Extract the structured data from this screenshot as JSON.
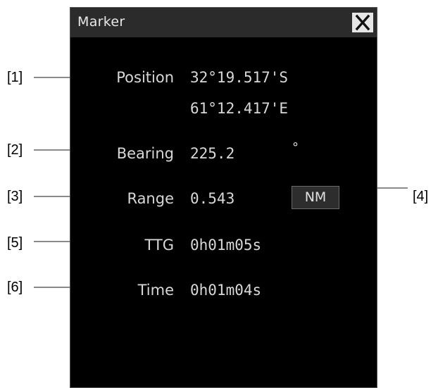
{
  "window": {
    "title": "Marker",
    "close_icon": "close-icon"
  },
  "callouts": [
    "[1]",
    "[2]",
    "[3]",
    "[4]",
    "[5]",
    "[6]"
  ],
  "fields": {
    "position": {
      "label": "Position",
      "latitude": "32°19.517'S",
      "longitude": "61°12.417'E"
    },
    "bearing": {
      "label": "Bearing",
      "value": "225.2",
      "unit": "°"
    },
    "range": {
      "label": "Range",
      "value": "0.543",
      "unit_button": "NM"
    },
    "ttg": {
      "label": "TTG",
      "value": "0h01m05s"
    },
    "time": {
      "label": "Time",
      "value": "0h01m04s"
    }
  },
  "colors": {
    "panel_background": "#000000",
    "titlebar": "#2b2b2b",
    "text": "#d8d8d8",
    "leader_line": "#8a8a8a",
    "close_button": "#e6e6e6"
  }
}
